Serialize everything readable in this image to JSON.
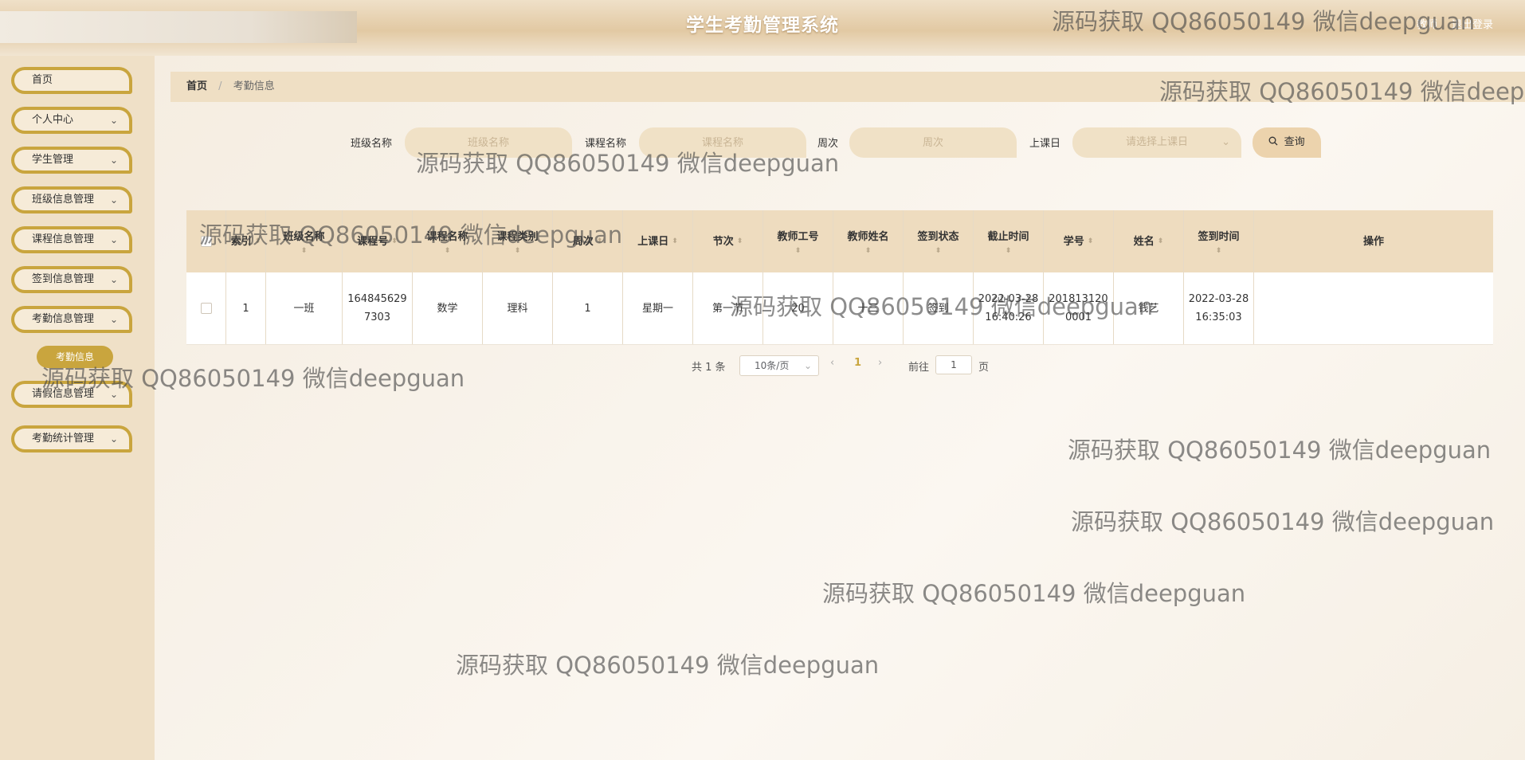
{
  "app": {
    "title": "学生考勤管理系统",
    "user_label": "教师 ",
    "logout_label": "退出登录"
  },
  "sidebar": {
    "items": [
      {
        "label": "首页",
        "has_children": false
      },
      {
        "label": "个人中心",
        "has_children": true
      },
      {
        "label": "学生管理",
        "has_children": true
      },
      {
        "label": "班级信息管理",
        "has_children": true
      },
      {
        "label": "课程信息管理",
        "has_children": true
      },
      {
        "label": "签到信息管理",
        "has_children": true
      },
      {
        "label": "考勤信息管理",
        "has_children": true
      },
      {
        "label": "请假信息管理",
        "has_children": true
      },
      {
        "label": "考勤统计管理",
        "has_children": true
      }
    ],
    "chevron": "⌄",
    "active_subitem": "考勤信息"
  },
  "breadcrumb": {
    "home": "首页",
    "separator": "/",
    "current": "考勤信息"
  },
  "search": {
    "class_label": "班级名称",
    "class_placeholder": "班级名称",
    "course_label": "课程名称",
    "course_placeholder": "课程名称",
    "week_label": "周次",
    "week_placeholder": "周次",
    "day_label": "上课日",
    "day_placeholder": "请选择上课日",
    "query_button": "查询",
    "search_icon": "search-icon"
  },
  "table": {
    "columns": [
      "",
      "索引",
      "班级名称",
      "课程号",
      "课程名称",
      "课程类别",
      "周次",
      "上课日",
      "节次",
      "教师工号",
      "教师姓名",
      "签到状态",
      "截止时间",
      "学号",
      "姓名",
      "签到时间",
      "操作"
    ],
    "rows": [
      {
        "index": "1",
        "class_name": "一班",
        "course_no": "1648456297303",
        "course_name": "数学",
        "course_type": "理科",
        "week": "1",
        "day": "星期一",
        "period": "第一节",
        "teacher_no": "20",
        "teacher_name": "十三",
        "status": "签到",
        "deadline": "2022-03-28 16:40:26",
        "student_no": "2018131200001",
        "student_name": "钱艺",
        "sign_time": "2022-03-28 16:35:03"
      }
    ]
  },
  "pagination": {
    "total": "共 1 条",
    "page_size": "10条/页",
    "current_page": "1",
    "goto_prefix": "前往",
    "goto_value": "1",
    "goto_suffix": "页"
  },
  "watermark": "源码获取 QQ86050149 微信deepguan",
  "colors": {
    "accent": "#c9a53e",
    "header_bg": "#e2c9a3",
    "sidebar_bg": "#efe0c7",
    "table_header_bg": "#eedcbf"
  }
}
